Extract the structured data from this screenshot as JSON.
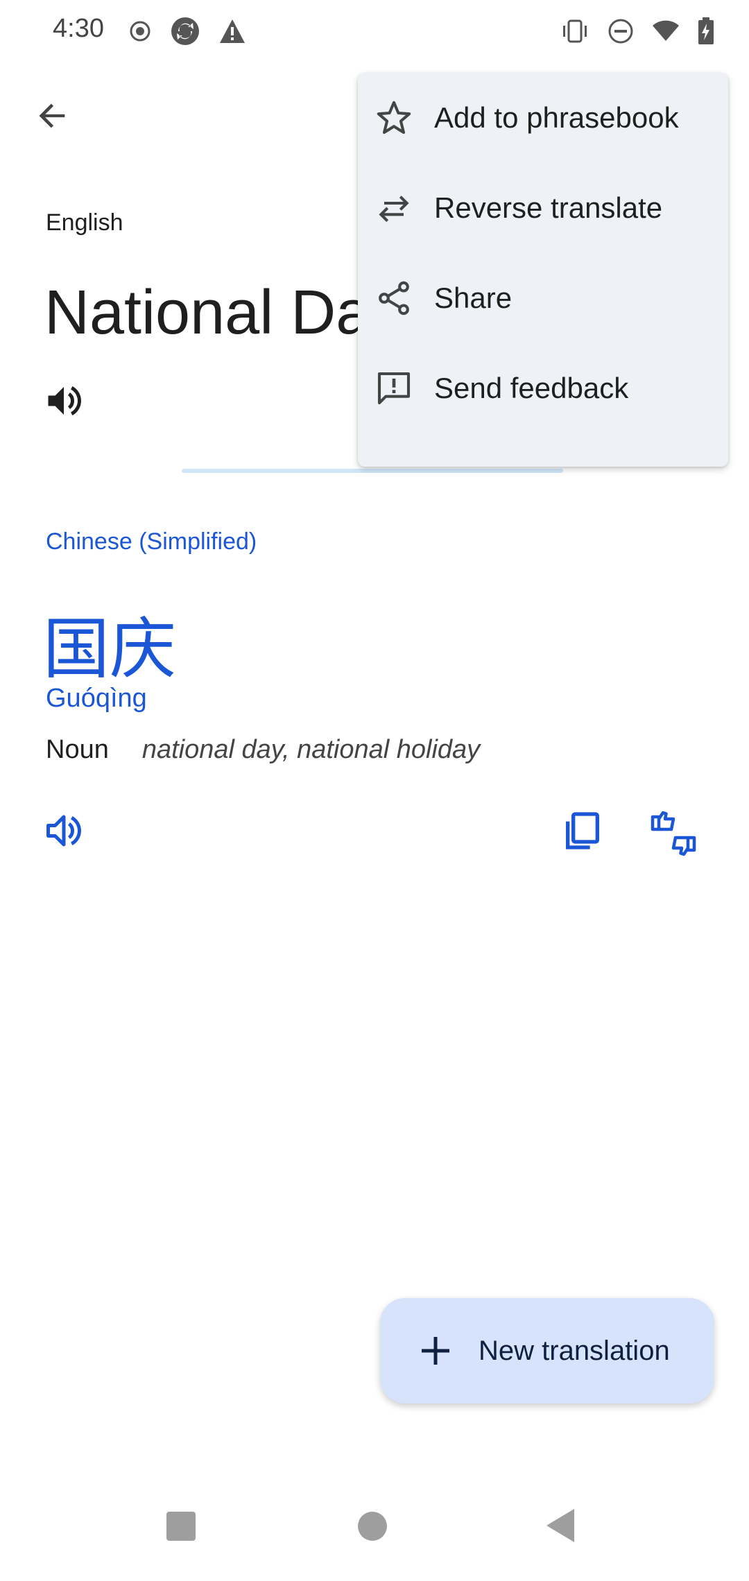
{
  "status_bar": {
    "time": "4:30",
    "left_icons": [
      "record-icon",
      "sync-icon",
      "warning-icon"
    ],
    "right_icons": [
      "vibrate-icon",
      "do-not-disturb-icon",
      "wifi-icon",
      "battery-charging-icon"
    ]
  },
  "source": {
    "language": "English",
    "text": "National Day"
  },
  "target": {
    "language": "Chinese (Simplified)",
    "text": "国庆",
    "romanization": "Guóqìng",
    "part_of_speech": "Noun",
    "meaning": "national day, national holiday"
  },
  "menu": {
    "items": [
      {
        "label": "Add to phrasebook",
        "icon": "star-icon"
      },
      {
        "label": "Reverse translate",
        "icon": "swap-icon"
      },
      {
        "label": "Share",
        "icon": "share-icon"
      },
      {
        "label": "Send feedback",
        "icon": "feedback-icon"
      }
    ]
  },
  "fab": {
    "label": "New translation",
    "icon": "plus-icon"
  },
  "colors": {
    "accent": "#1a56d6",
    "menu_bg": "#eef1f6",
    "fab_bg": "#d7e3fa"
  }
}
